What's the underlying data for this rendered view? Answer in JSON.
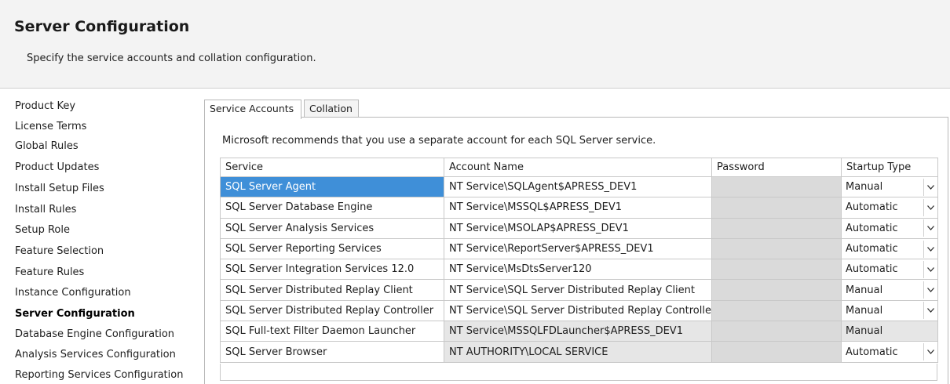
{
  "header": {
    "title": "Server Configuration",
    "subtitle": "Specify the service accounts and collation configuration."
  },
  "sidebar": {
    "items": [
      {
        "label": "Product Key",
        "active": false
      },
      {
        "label": "License Terms",
        "active": false
      },
      {
        "label": "Global Rules",
        "active": false
      },
      {
        "label": "Product Updates",
        "active": false
      },
      {
        "label": "Install Setup Files",
        "active": false
      },
      {
        "label": "Install Rules",
        "active": false
      },
      {
        "label": "Setup Role",
        "active": false
      },
      {
        "label": "Feature Selection",
        "active": false
      },
      {
        "label": "Feature Rules",
        "active": false
      },
      {
        "label": "Instance Configuration",
        "active": false
      },
      {
        "label": "Server Configuration",
        "active": true
      },
      {
        "label": "Database Engine Configuration",
        "active": false
      },
      {
        "label": "Analysis Services Configuration",
        "active": false
      },
      {
        "label": "Reporting Services Configuration",
        "active": false
      }
    ]
  },
  "tabs": [
    {
      "label": "Service Accounts",
      "active": true
    },
    {
      "label": "Collation",
      "active": false
    }
  ],
  "main": {
    "recommendation": "Microsoft recommends that you use a separate account for each SQL Server service."
  },
  "grid": {
    "headers": {
      "service": "Service",
      "account": "Account Name",
      "password": "Password",
      "startup": "Startup Type"
    },
    "rows": [
      {
        "service": "SQL Server Agent",
        "account": "NT Service\\SQLAgent$APRESS_DEV1",
        "password": "",
        "startup": "Manual",
        "has_dropdown": true,
        "selected": true,
        "account_readonly": false
      },
      {
        "service": "SQL Server Database Engine",
        "account": "NT Service\\MSSQL$APRESS_DEV1",
        "password": "",
        "startup": "Automatic",
        "has_dropdown": true,
        "selected": false,
        "account_readonly": false
      },
      {
        "service": "SQL Server Analysis Services",
        "account": "NT Service\\MSOLAP$APRESS_DEV1",
        "password": "",
        "startup": "Automatic",
        "has_dropdown": true,
        "selected": false,
        "account_readonly": false
      },
      {
        "service": "SQL Server Reporting Services",
        "account": "NT Service\\ReportServer$APRESS_DEV1",
        "password": "",
        "startup": "Automatic",
        "has_dropdown": true,
        "selected": false,
        "account_readonly": false
      },
      {
        "service": "SQL Server Integration Services 12.0",
        "account": "NT Service\\MsDtsServer120",
        "password": "",
        "startup": "Automatic",
        "has_dropdown": true,
        "selected": false,
        "account_readonly": false
      },
      {
        "service": "SQL Server Distributed Replay Client",
        "account": "NT Service\\SQL Server Distributed Replay Client",
        "password": "",
        "startup": "Manual",
        "has_dropdown": true,
        "selected": false,
        "account_readonly": false
      },
      {
        "service": "SQL Server Distributed Replay Controller",
        "account": "NT Service\\SQL Server Distributed Replay Controller",
        "password": "",
        "startup": "Manual",
        "has_dropdown": true,
        "selected": false,
        "account_readonly": false
      },
      {
        "service": "SQL Full-text Filter Daemon Launcher",
        "account": "NT Service\\MSSQLFDLauncher$APRESS_DEV1",
        "password": "",
        "startup": "Manual",
        "has_dropdown": false,
        "selected": false,
        "account_readonly": true
      },
      {
        "service": "SQL Server Browser",
        "account": "NT AUTHORITY\\LOCAL SERVICE",
        "password": "",
        "startup": "Automatic",
        "has_dropdown": true,
        "selected": false,
        "account_readonly": true
      }
    ]
  },
  "colors": {
    "selection": "#3f8fd8",
    "readonly_cell": "#e6e6e6",
    "password_cell": "#dadada",
    "header_bg": "#f3f3f3"
  },
  "icons": {
    "dropdown": "chevron-down-icon"
  }
}
